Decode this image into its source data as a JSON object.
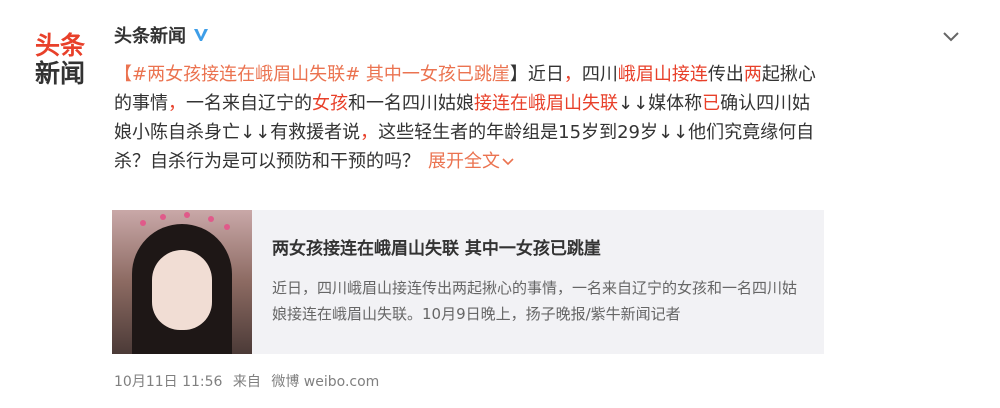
{
  "account": {
    "avatar_line1": "头条",
    "avatar_line2": "新闻",
    "name": "头条新闻",
    "verified_icon": "verified-v-icon"
  },
  "post": {
    "segments": [
      {
        "text": "【#两女孩接连在峨眉山失联# 其中一女孩已跳崖",
        "style": "hl"
      },
      {
        "text": "】近日",
        "style": "plain"
      },
      {
        "text": "，",
        "style": "red"
      },
      {
        "text": "四川",
        "style": "plain"
      },
      {
        "text": "峨眉山接连",
        "style": "red"
      },
      {
        "text": "传出",
        "style": "plain"
      },
      {
        "text": "两",
        "style": "red"
      },
      {
        "text": "起揪心的事情",
        "style": "plain"
      },
      {
        "text": "，",
        "style": "red"
      },
      {
        "text": "一名来自辽宁的",
        "style": "plain"
      },
      {
        "text": "女孩",
        "style": "red"
      },
      {
        "text": "和一名四川姑娘",
        "style": "plain"
      },
      {
        "text": "接连在峨眉山失联",
        "style": "red"
      },
      {
        "text": "↓↓媒体称",
        "style": "plain"
      },
      {
        "text": "已",
        "style": "red"
      },
      {
        "text": "确认四川姑娘小陈自杀身亡↓↓有救援者说",
        "style": "plain"
      },
      {
        "text": "，",
        "style": "red"
      },
      {
        "text": "这些轻生者的年龄组是15岁到29岁↓↓他们究竟缘何自杀？自杀行为是可以预防和干预的吗？",
        "style": "plain"
      }
    ],
    "expand_label": "展开全文"
  },
  "card": {
    "title": "两女孩接连在峨眉山失联 其中一女孩已跳崖",
    "description": "近日，四川峨眉山接连传出两起揪心的事情，一名来自辽宁的女孩和一名四川姑娘接连在峨眉山失联。10月9日晚上，扬子晚报/紫牛新闻记者"
  },
  "meta": {
    "time": "10月11日 11:56",
    "source_prefix": "来自",
    "source": "微博 weibo.com"
  },
  "colors": {
    "accent": "#eb7350",
    "red": "#e8402a",
    "verify_blue": "#3e9ee8"
  }
}
